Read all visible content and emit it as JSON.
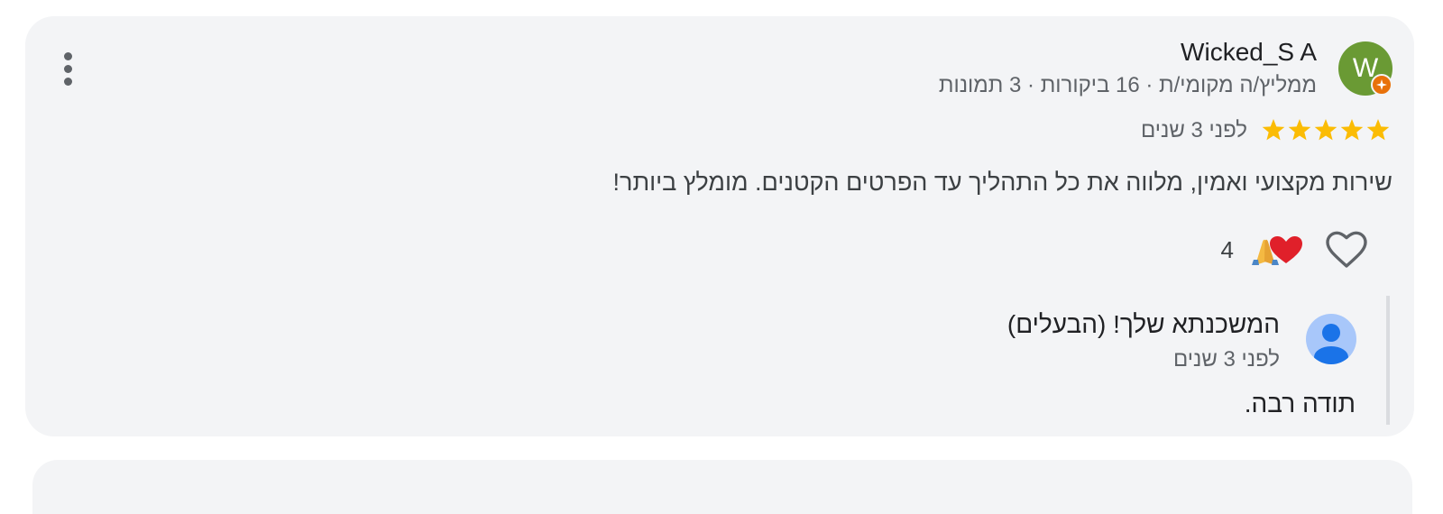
{
  "review": {
    "reviewer": {
      "name": "Wicked_S A",
      "avatar_letter": "W",
      "avatar_color": "#6a9a34",
      "meta": "ממליץ/ה מקומי/ת · 16 ביקורות · 3 תמונות",
      "badge_icon": "local-guide-badge-icon"
    },
    "rating": {
      "stars": 5,
      "max": 5,
      "color": "#fbbc04"
    },
    "date": "לפני 3 שנים",
    "text": "שירות מקצועי ואמין, מלווה את כל התהליך עד הפרטים הקטנים. מומלץ ביותר!",
    "reactions": {
      "icons": [
        "heart-reaction-icon",
        "pray-reaction-icon"
      ],
      "count": "4"
    },
    "like_icon": "heart-outline-icon",
    "more_icon": "more-vert-icon"
  },
  "owner_reply": {
    "name": "המשכנתא שלך! (הבעלים)",
    "date": "לפני 3 שנים",
    "text": "תודה רבה.",
    "avatar_icon": "person-icon",
    "avatar_color": "#a8c7fa"
  },
  "colors": {
    "card_bg": "#f3f4f6",
    "text_primary": "#202124",
    "text_secondary": "#5f6368",
    "badge": "#e8710a"
  }
}
